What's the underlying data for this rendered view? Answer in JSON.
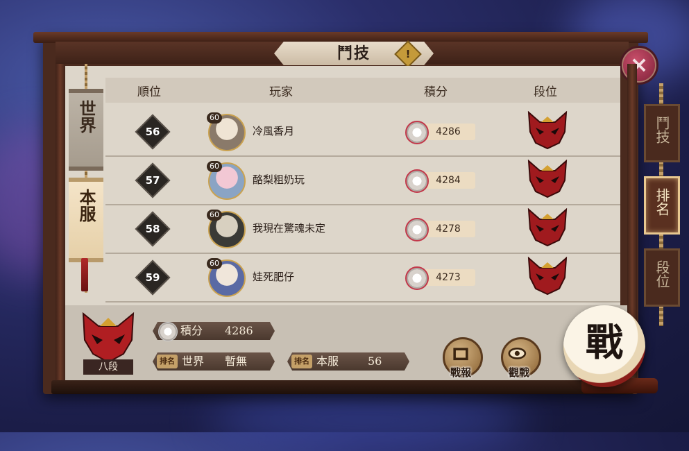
{
  "title": "鬥技",
  "left_tabs": [
    {
      "label": "世界",
      "active": false
    },
    {
      "label": "本服",
      "active": true
    }
  ],
  "right_tabs": [
    {
      "label": "鬥技",
      "active": false
    },
    {
      "label": "排名",
      "active": true
    },
    {
      "label": "段位",
      "active": false
    }
  ],
  "columns": {
    "rank": "順位",
    "player": "玩家",
    "score": "積分",
    "tier": "段位"
  },
  "rows": [
    {
      "rank": "56",
      "level": "60",
      "name": "冷風香月",
      "score": "4286"
    },
    {
      "rank": "57",
      "level": "60",
      "name": "酪梨粗奶玩",
      "score": "4284"
    },
    {
      "rank": "58",
      "level": "60",
      "name": "我現在驚魂未定",
      "score": "4278"
    },
    {
      "rank": "59",
      "level": "60",
      "name": "娃死肥仔",
      "score": "4273"
    }
  ],
  "me": {
    "tier": "八段",
    "score_label": "積分",
    "score": "4286",
    "world_badge": "排名",
    "world_label": "世界",
    "world_value": "暫無",
    "server_badge": "排名",
    "server_label": "本服",
    "server_value": "56"
  },
  "buttons": {
    "report": "戰報",
    "watch": "觀戰",
    "fight": "戰"
  },
  "colors": {
    "mask_red": "#b01e22",
    "accent_gold": "#c49a3a",
    "frame_brown": "#4a2a1e"
  }
}
